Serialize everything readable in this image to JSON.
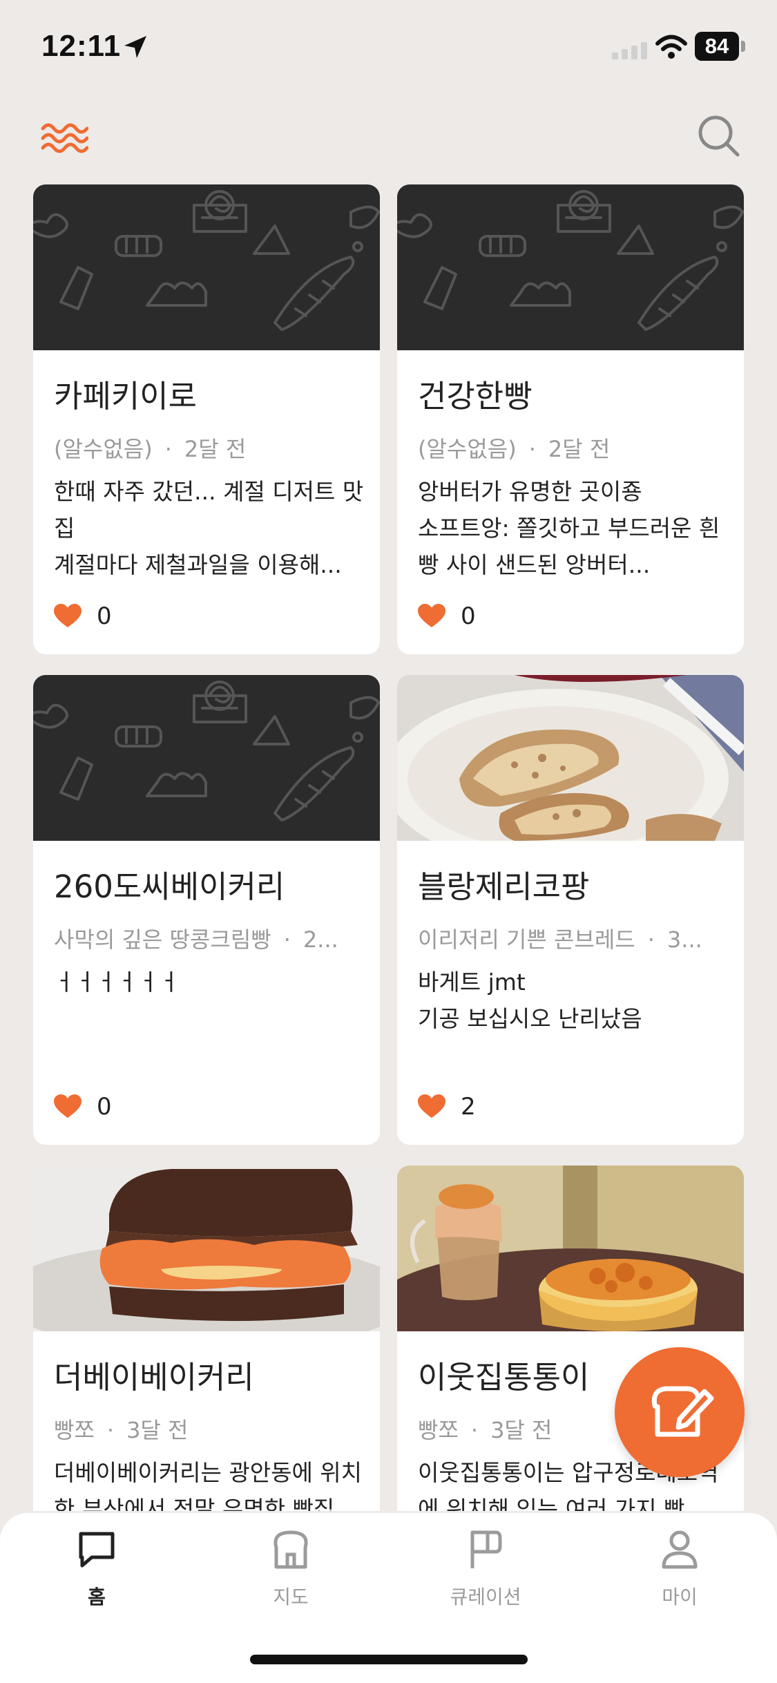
{
  "status_bar": {
    "time": "12:11",
    "battery": "84",
    "icons": [
      "location-arrow-icon",
      "signal-icon",
      "wifi-icon",
      "battery-icon"
    ]
  },
  "header": {
    "logo_icon": "waves-logo-icon",
    "search_icon": "search-icon"
  },
  "cards": [
    {
      "title": "카페키이로",
      "author": "(알수없음)",
      "time": "2달 전",
      "description": "한때 자주 갔던... 계절 디저트 맛집\n계절마다 제철과일을 이용해...",
      "likes": "0",
      "image": "placeholder-pattern"
    },
    {
      "title": "건강한빵",
      "author": "(알수없음)",
      "time": "2달 전",
      "description": "앙버터가 유명한 곳이죵\n소프트앙: 쫄깃하고 부드러운 흰빵 사이 샌드된 앙버터...",
      "likes": "0",
      "image": "placeholder-pattern"
    },
    {
      "title": "260도씨베이커리",
      "author": "사막의 깊은 땅콩크림빵",
      "time": "2...",
      "description": "ㅓㅓㅓㅓㅓㅓ",
      "likes": "0",
      "image": "placeholder-pattern"
    },
    {
      "title": "블랑제리코팡",
      "author": "이리저리 기쁜 콘브레드",
      "time": "3...",
      "description": "바게트 jmt\n기공 보십시오 난리났음",
      "likes": "2",
      "image": "baguette-photo"
    },
    {
      "title": "더베이베이커리",
      "author": "빵쪼",
      "time": "3달 전",
      "description": "더베이베이커리는 광안동에 위치한 부산에서 정말 유명한 빵집",
      "likes": "",
      "image": "sandwich-cake-photo"
    },
    {
      "title": "이웃집통통이",
      "author": "빵쪼",
      "time": "3달 전",
      "description": "이웃집통통이는 압구정로데오역에 위치해 있는 여러 가지 빵",
      "likes": "",
      "image": "drink-dessert-photo"
    }
  ],
  "fab": {
    "icon": "write-bread-icon"
  },
  "tabs": [
    {
      "label": "홈",
      "icon": "home-bubble-icon",
      "active": true
    },
    {
      "label": "지도",
      "icon": "bread-map-icon",
      "active": false
    },
    {
      "label": "큐레이션",
      "icon": "flag-icon",
      "active": false
    },
    {
      "label": "마이",
      "icon": "person-icon",
      "active": false
    }
  ],
  "colors": {
    "accent": "#ef6c33",
    "background": "#eeeae8",
    "placeholder": "#2b2b2b"
  }
}
